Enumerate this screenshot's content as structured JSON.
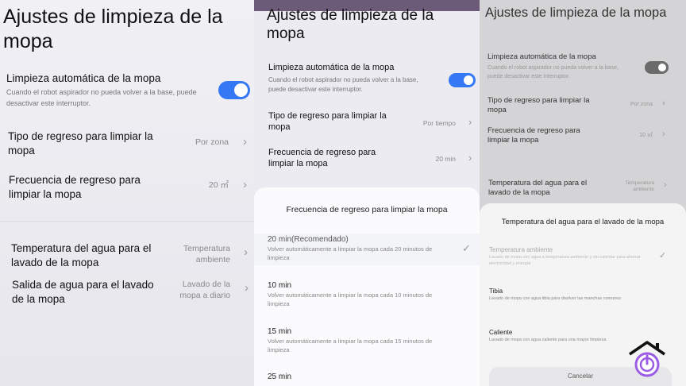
{
  "panel1": {
    "title": "Ajustes de limpieza de la mopa",
    "auto_clean": {
      "label": "Limpieza automática de la mopa",
      "description": "Cuando el robot aspirador no pueda volver a la base, puede desactivar este interruptor.",
      "enabled": true
    },
    "settings": [
      {
        "label": "Tipo de regreso para limpiar la mopa",
        "value": "Por zona"
      },
      {
        "label": "Frecuencia de regreso para limpiar la mopa",
        "value": "20 ㎡"
      },
      {
        "label": "Temperatura del agua para el lavado de la mopa",
        "value": "Temperatura ambiente"
      },
      {
        "label": "Salida de agua para el lavado de la mopa",
        "value": "Lavado de la mopa a diario"
      }
    ]
  },
  "panel2": {
    "title": "Ajustes de limpieza de la mopa",
    "auto_clean": {
      "label": "Limpieza automática de la mopa",
      "description": "Cuando el robot aspirador no pueda volver a la base, puede desactivar este interruptor.",
      "enabled": true
    },
    "settings": [
      {
        "label": "Tipo de regreso para limpiar la mopa",
        "value": "Por tiempo"
      },
      {
        "label": "Frecuencia de regreso para limpiar la mopa",
        "value": "20 min"
      }
    ],
    "sheet": {
      "title": "Frecuencia de regreso para limpiar la mopa",
      "options": [
        {
          "title": "20 min(Recomendado)",
          "desc": "Volver automáticamente a limpiar la mopa cada 20 minutos de limpieza",
          "selected": true
        },
        {
          "title": "10 min",
          "desc": "Volver automáticamente a limpiar la mopa cada 10 minutos de limpieza",
          "selected": false
        },
        {
          "title": "15 min",
          "desc": "Volver automáticamente a limpiar la mopa cada 15 minutos de limpieza",
          "selected": false
        },
        {
          "title": "25 min",
          "desc": "",
          "selected": false
        }
      ]
    }
  },
  "panel3": {
    "title": "Ajustes de limpieza de la mopa",
    "auto_clean": {
      "label": "Limpieza automática de la mopa",
      "description": "Cuando el robot aspirador no pueda volver a la base, puede desactivar este interruptor.",
      "enabled": true
    },
    "settings": [
      {
        "label": "Tipo de regreso para limpiar la mopa",
        "value": "Por zona"
      },
      {
        "label": "Frecuencia de regreso para limpiar la mopa",
        "value": "10 ㎡"
      },
      {
        "label": "Temperatura del agua para el lavado de la mopa",
        "value": "Temperatura ambiente"
      }
    ],
    "sheet": {
      "title": "Temperatura del agua para el lavado de la mopa",
      "options": [
        {
          "title": "Temperatura ambiente",
          "desc": "Lavado de mopa con agua a temperatura ambiente y sin calentar para ahorrar electricidad y energía",
          "selected": true
        },
        {
          "title": "Tibia",
          "desc": "Lavado de mopa con agua tibia para disolver las manchas comunes",
          "selected": false
        },
        {
          "title": "Caliente",
          "desc": "Lavado de mopa con agua caliente para una mayor limpieza",
          "selected": false
        }
      ],
      "cancel_label": "Cancelar"
    }
  },
  "colors": {
    "accent": "#3478f6",
    "toggle_disabled": "#6b6b6b",
    "logo": "#9b5de5"
  },
  "icons": {
    "chevron": "›",
    "check": "✓",
    "logo": "house-power-icon"
  }
}
